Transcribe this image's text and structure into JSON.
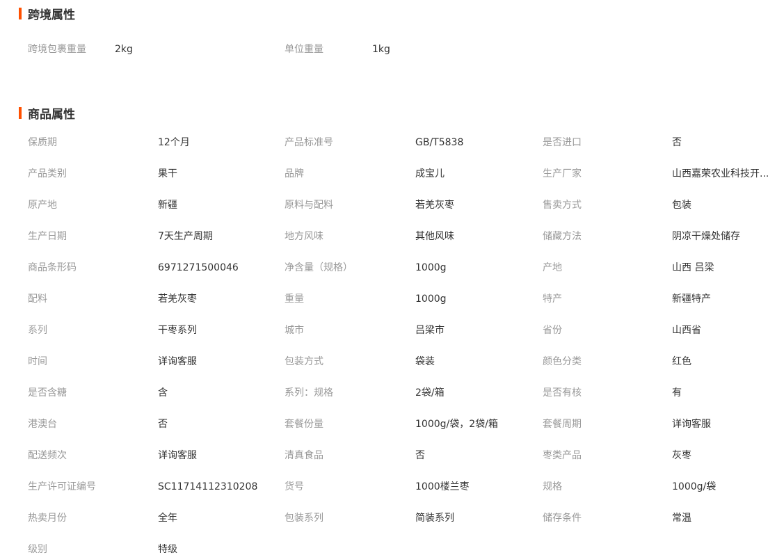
{
  "cross_border": {
    "title": "跨境属性",
    "accent_color": "#ff5000",
    "items": [
      {
        "label": "跨境包裹重量",
        "value": "2kg"
      },
      {
        "label": "单位重量",
        "value": "1kg"
      }
    ]
  },
  "product": {
    "title": "商品属性",
    "rows": [
      [
        {
          "label": "保质期",
          "value": "12个月"
        },
        {
          "label": "产品标准号",
          "value": "GB/T5838"
        },
        {
          "label": "是否进口",
          "value": "否"
        }
      ],
      [
        {
          "label": "产品类别",
          "value": "果干"
        },
        {
          "label": "品牌",
          "value": "成宝儿"
        },
        {
          "label": "生产厂家",
          "value": "山西嘉荣农业科技开..."
        }
      ],
      [
        {
          "label": "原产地",
          "value": "新疆"
        },
        {
          "label": "原料与配料",
          "value": "若羌灰枣"
        },
        {
          "label": "售卖方式",
          "value": "包装"
        }
      ],
      [
        {
          "label": "生产日期",
          "value": "7天生产周期"
        },
        {
          "label": "地方风味",
          "value": "其他风味"
        },
        {
          "label": "储藏方法",
          "value": "阴凉干燥处储存"
        }
      ],
      [
        {
          "label": "商品条形码",
          "value": "6971271500046"
        },
        {
          "label": "净含量（规格）",
          "value": "1000g"
        },
        {
          "label": "产地",
          "value": "山西 吕梁"
        }
      ],
      [
        {
          "label": "配料",
          "value": "若羌灰枣"
        },
        {
          "label": "重量",
          "value": "1000g"
        },
        {
          "label": "特产",
          "value": "新疆特产"
        }
      ],
      [
        {
          "label": "系列",
          "value": "干枣系列"
        },
        {
          "label": "城市",
          "value": "吕梁市"
        },
        {
          "label": "省份",
          "value": "山西省"
        }
      ],
      [
        {
          "label": "时间",
          "value": "详询客服"
        },
        {
          "label": "包装方式",
          "value": "袋装"
        },
        {
          "label": "颜色分类",
          "value": "红色"
        }
      ],
      [
        {
          "label": "是否含糖",
          "value": "含"
        },
        {
          "label": "系列：规格",
          "value": "2袋/箱"
        },
        {
          "label": "是否有核",
          "value": "有"
        }
      ],
      [
        {
          "label": "港澳台",
          "value": "否"
        },
        {
          "label": "套餐份量",
          "value": "1000g/袋，2袋/箱"
        },
        {
          "label": "套餐周期",
          "value": "详询客服"
        }
      ],
      [
        {
          "label": "配送频次",
          "value": "详询客服"
        },
        {
          "label": "清真食品",
          "value": "否"
        },
        {
          "label": "枣类产品",
          "value": "灰枣"
        }
      ],
      [
        {
          "label": "生产许可证编号",
          "value": "SC11714112310208"
        },
        {
          "label": "货号",
          "value": "1000楼兰枣"
        },
        {
          "label": "规格",
          "value": "1000g/袋"
        }
      ],
      [
        {
          "label": "热卖月份",
          "value": "全年"
        },
        {
          "label": "包装系列",
          "value": "简装系列"
        },
        {
          "label": "储存条件",
          "value": "常温"
        }
      ],
      [
        {
          "label": "级别",
          "value": "特级"
        }
      ]
    ]
  }
}
